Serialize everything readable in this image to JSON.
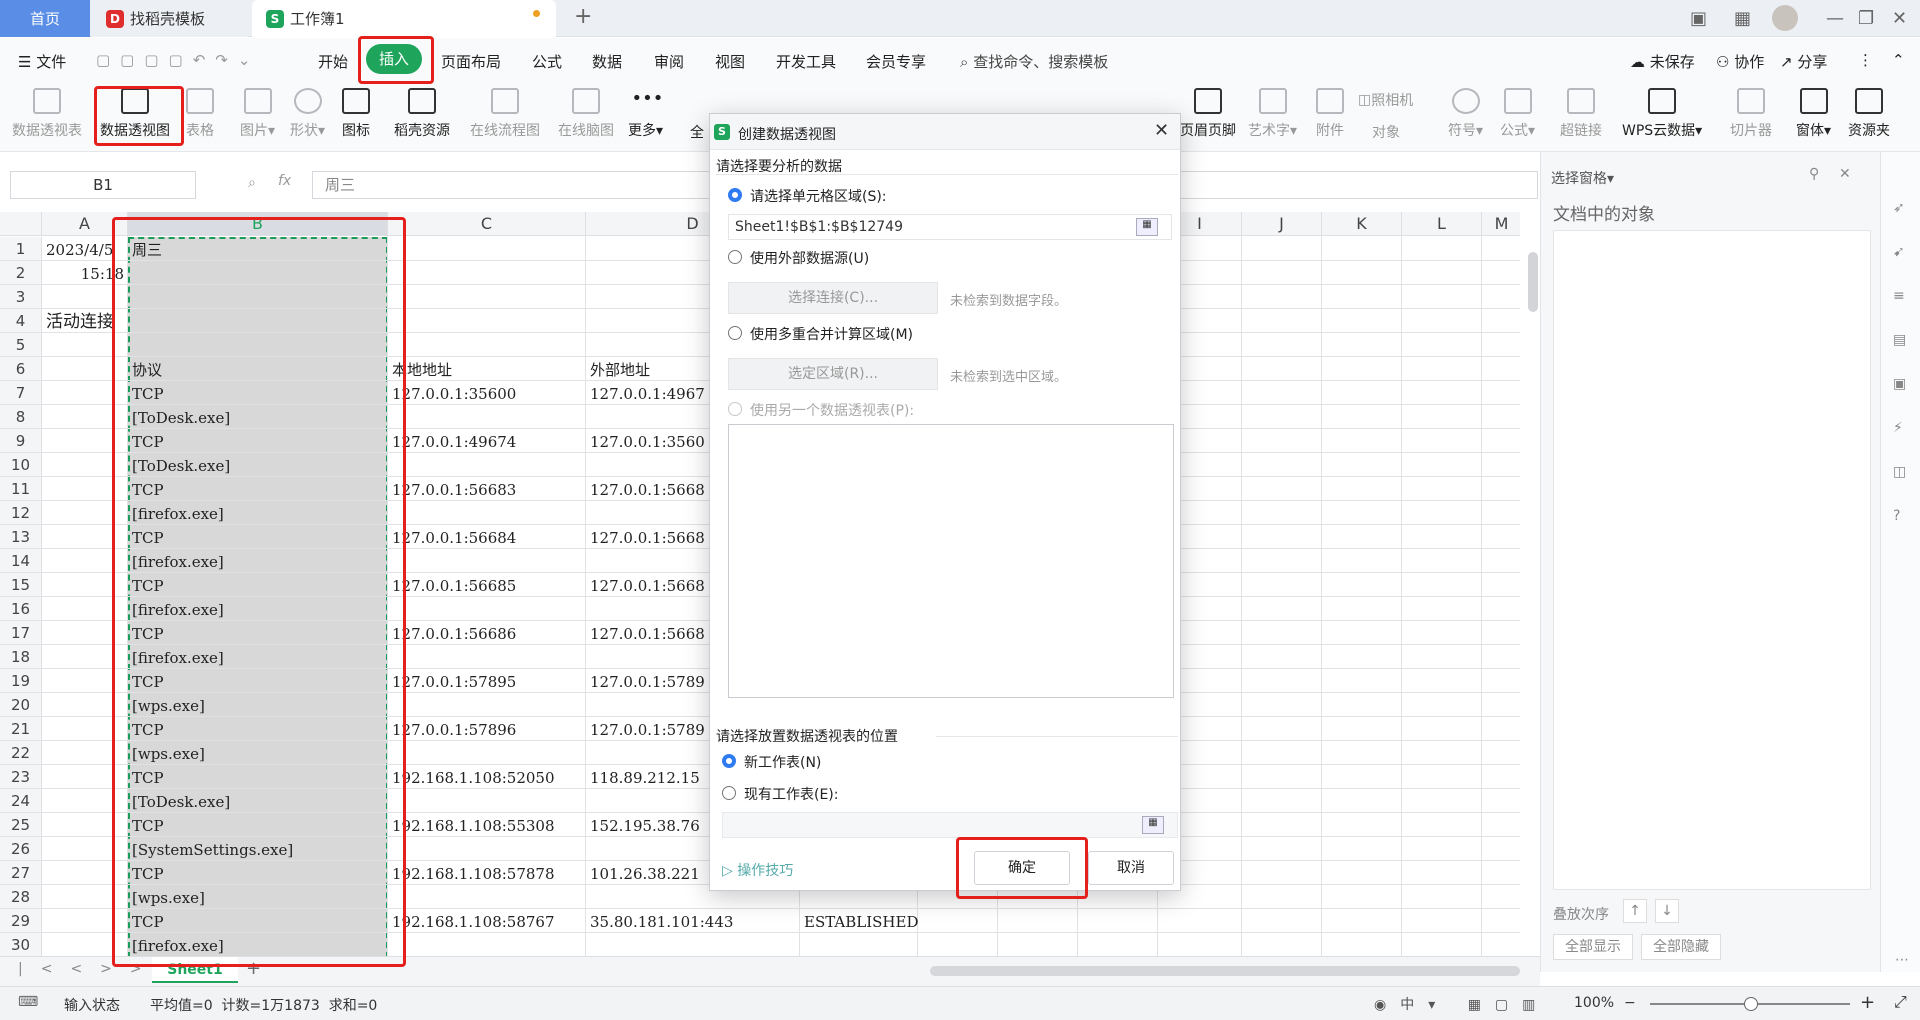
{
  "tabs": {
    "home": "首页",
    "template": "找稻壳模板",
    "workbook": "工作簿1"
  },
  "menu": {
    "file": "文件",
    "items": [
      "开始",
      "插入",
      "页面布局",
      "公式",
      "数据",
      "审阅",
      "视图",
      "开发工具",
      "会员专享"
    ],
    "search": "查找命令、搜索模板",
    "unsaved": "未保存",
    "collab": "协作",
    "share": "分享"
  },
  "ribbon": {
    "items": [
      "数据透视表",
      "数据透视图",
      "表格",
      "图片▾",
      "形状▾",
      "图标",
      "稻壳资源",
      "在线流程图",
      "在线脑图",
      "更多▾",
      "全",
      "页眉页脚",
      "艺术字▾",
      "附件",
      "对象",
      "符号▾",
      "公式▾",
      "超链接",
      "WPS云数据▾",
      "切片器",
      "窗体▾",
      "资源夹"
    ],
    "camera": "照相机"
  },
  "formula": {
    "namebox": "B1",
    "fx": "fx",
    "content": "周三"
  },
  "columns": [
    "A",
    "B",
    "C",
    "D",
    "",
    "",
    "",
    "",
    "I",
    "J",
    "K",
    "L",
    "M"
  ],
  "rows": [
    "1",
    "2",
    "3",
    "4",
    "5",
    "6",
    "7",
    "8",
    "9",
    "10",
    "11",
    "12",
    "13",
    "14",
    "15",
    "16",
    "17",
    "18",
    "19",
    "20",
    "21",
    "22",
    "23",
    "24",
    "25",
    "26",
    "27",
    "28",
    "29",
    "30"
  ],
  "cells": {
    "a1": "2023/4/5",
    "a2": "15:18",
    "a4": "活动连接",
    "b": [
      "周三",
      "",
      "",
      "",
      "",
      "协议",
      "TCP",
      "[ToDesk.exe]",
      "TCP",
      "[ToDesk.exe]",
      "TCP",
      "[firefox.exe]",
      "TCP",
      "[firefox.exe]",
      "TCP",
      "[firefox.exe]",
      "TCP",
      "[firefox.exe]",
      "TCP",
      "[wps.exe]",
      "TCP",
      "[wps.exe]",
      "TCP",
      "[ToDesk.exe]",
      "TCP",
      "[SystemSettings.exe]",
      "TCP",
      "[wps.exe]",
      "TCP",
      "[firefox.exe]"
    ],
    "c": [
      "",
      "",
      "",
      "",
      "",
      "本地地址",
      "127.0.0.1:35600",
      "",
      "127.0.0.1:49674",
      "",
      "127.0.0.1:56683",
      "",
      "127.0.0.1:56684",
      "",
      "127.0.0.1:56685",
      "",
      "127.0.0.1:56686",
      "",
      "127.0.0.1:57895",
      "",
      "127.0.0.1:57896",
      "",
      "192.168.1.108:52050",
      "",
      "192.168.1.108:55308",
      "",
      "192.168.1.108:57878",
      "",
      "192.168.1.108:58767",
      ""
    ],
    "d": [
      "",
      "",
      "",
      "",
      "",
      "外部地址",
      "127.0.0.1:4967",
      "",
      "127.0.0.1:3560",
      "",
      "127.0.0.1:5668",
      "",
      "127.0.0.1:5668",
      "",
      "127.0.0.1:5668",
      "",
      "127.0.0.1:5668",
      "",
      "127.0.0.1:5789",
      "",
      "127.0.0.1:5789",
      "",
      "118.89.212.15",
      "",
      "152.195.38.76",
      "",
      "101.26.38.221",
      "",
      "35.80.181.101:443",
      ""
    ],
    "e29": "ESTABLISHED"
  },
  "dialog": {
    "title": "创建数据透视图",
    "close": "✕",
    "section1": "请选择要分析的数据",
    "opt_range": "请选择单元格区域(S):",
    "range_value": "Sheet1!$B$1:$B$12749",
    "opt_external": "使用外部数据源(U)",
    "btn_connect": "选择连接(C)...",
    "no_field": "未检索到数据字段。",
    "opt_multi": "使用多重合并计算区域(M)",
    "btn_region": "选定区域(R)...",
    "no_region": "未检索到选中区域。",
    "opt_other": "使用另一个数据透视表(P):",
    "section2": "请选择放置数据透视表的位置",
    "opt_new": "新工作表(N)",
    "opt_existing": "现有工作表(E):",
    "tips": "操作技巧",
    "ok": "确定",
    "cancel": "取消"
  },
  "rightpane": {
    "title": "选择窗格▾",
    "objects": "文档中的对象",
    "order": "叠放次序",
    "show_all": "全部显示",
    "hide_all": "全部隐藏"
  },
  "sheet": {
    "name": "Sheet1"
  },
  "status": {
    "mode": "输入状态",
    "stats": "平均值=0  计数=1万1873  求和=0",
    "zoom": "100%"
  }
}
